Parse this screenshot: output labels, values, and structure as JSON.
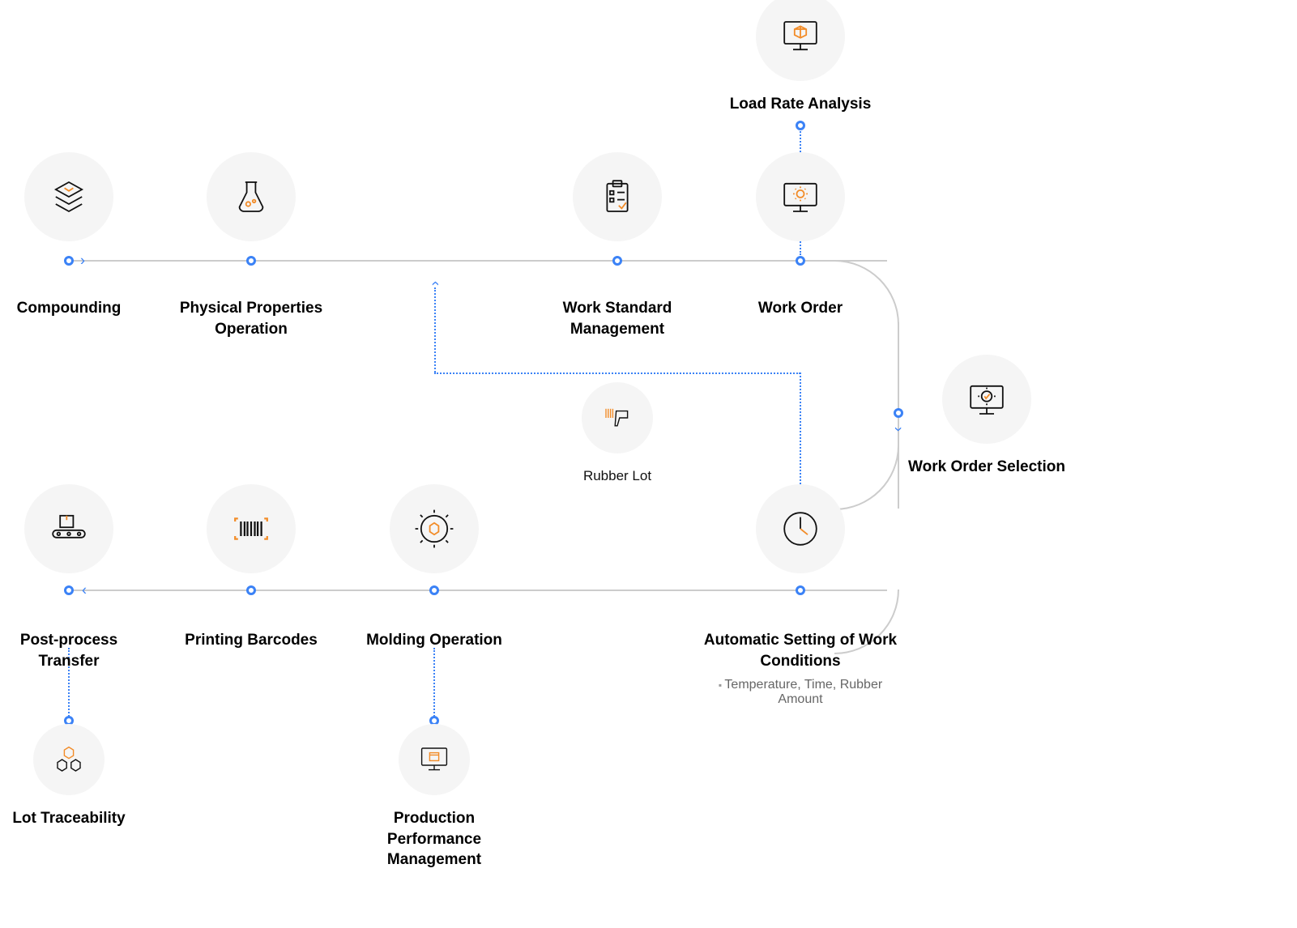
{
  "nodes": {
    "load_rate": {
      "label": "Load Rate Analysis"
    },
    "compounding": {
      "label": "Compounding"
    },
    "physical_properties": {
      "label": "Physical Properties Operation"
    },
    "work_standard": {
      "label": "Work Standard Management"
    },
    "work_order": {
      "label": "Work Order"
    },
    "work_order_selection": {
      "label": "Work Order Selection"
    },
    "rubber_lot": {
      "label": "Rubber Lot"
    },
    "auto_setting": {
      "label": "Automatic Setting of Work Conditions",
      "sub": "Temperature, Time, Rubber Amount"
    },
    "molding": {
      "label": "Molding Operation"
    },
    "printing_barcodes": {
      "label": "Printing Barcodes"
    },
    "post_process": {
      "label": "Post-process Transfer"
    },
    "lot_traceability": {
      "label": "Lot Traceability"
    },
    "production_performance": {
      "label": "Production Performance Management"
    }
  }
}
